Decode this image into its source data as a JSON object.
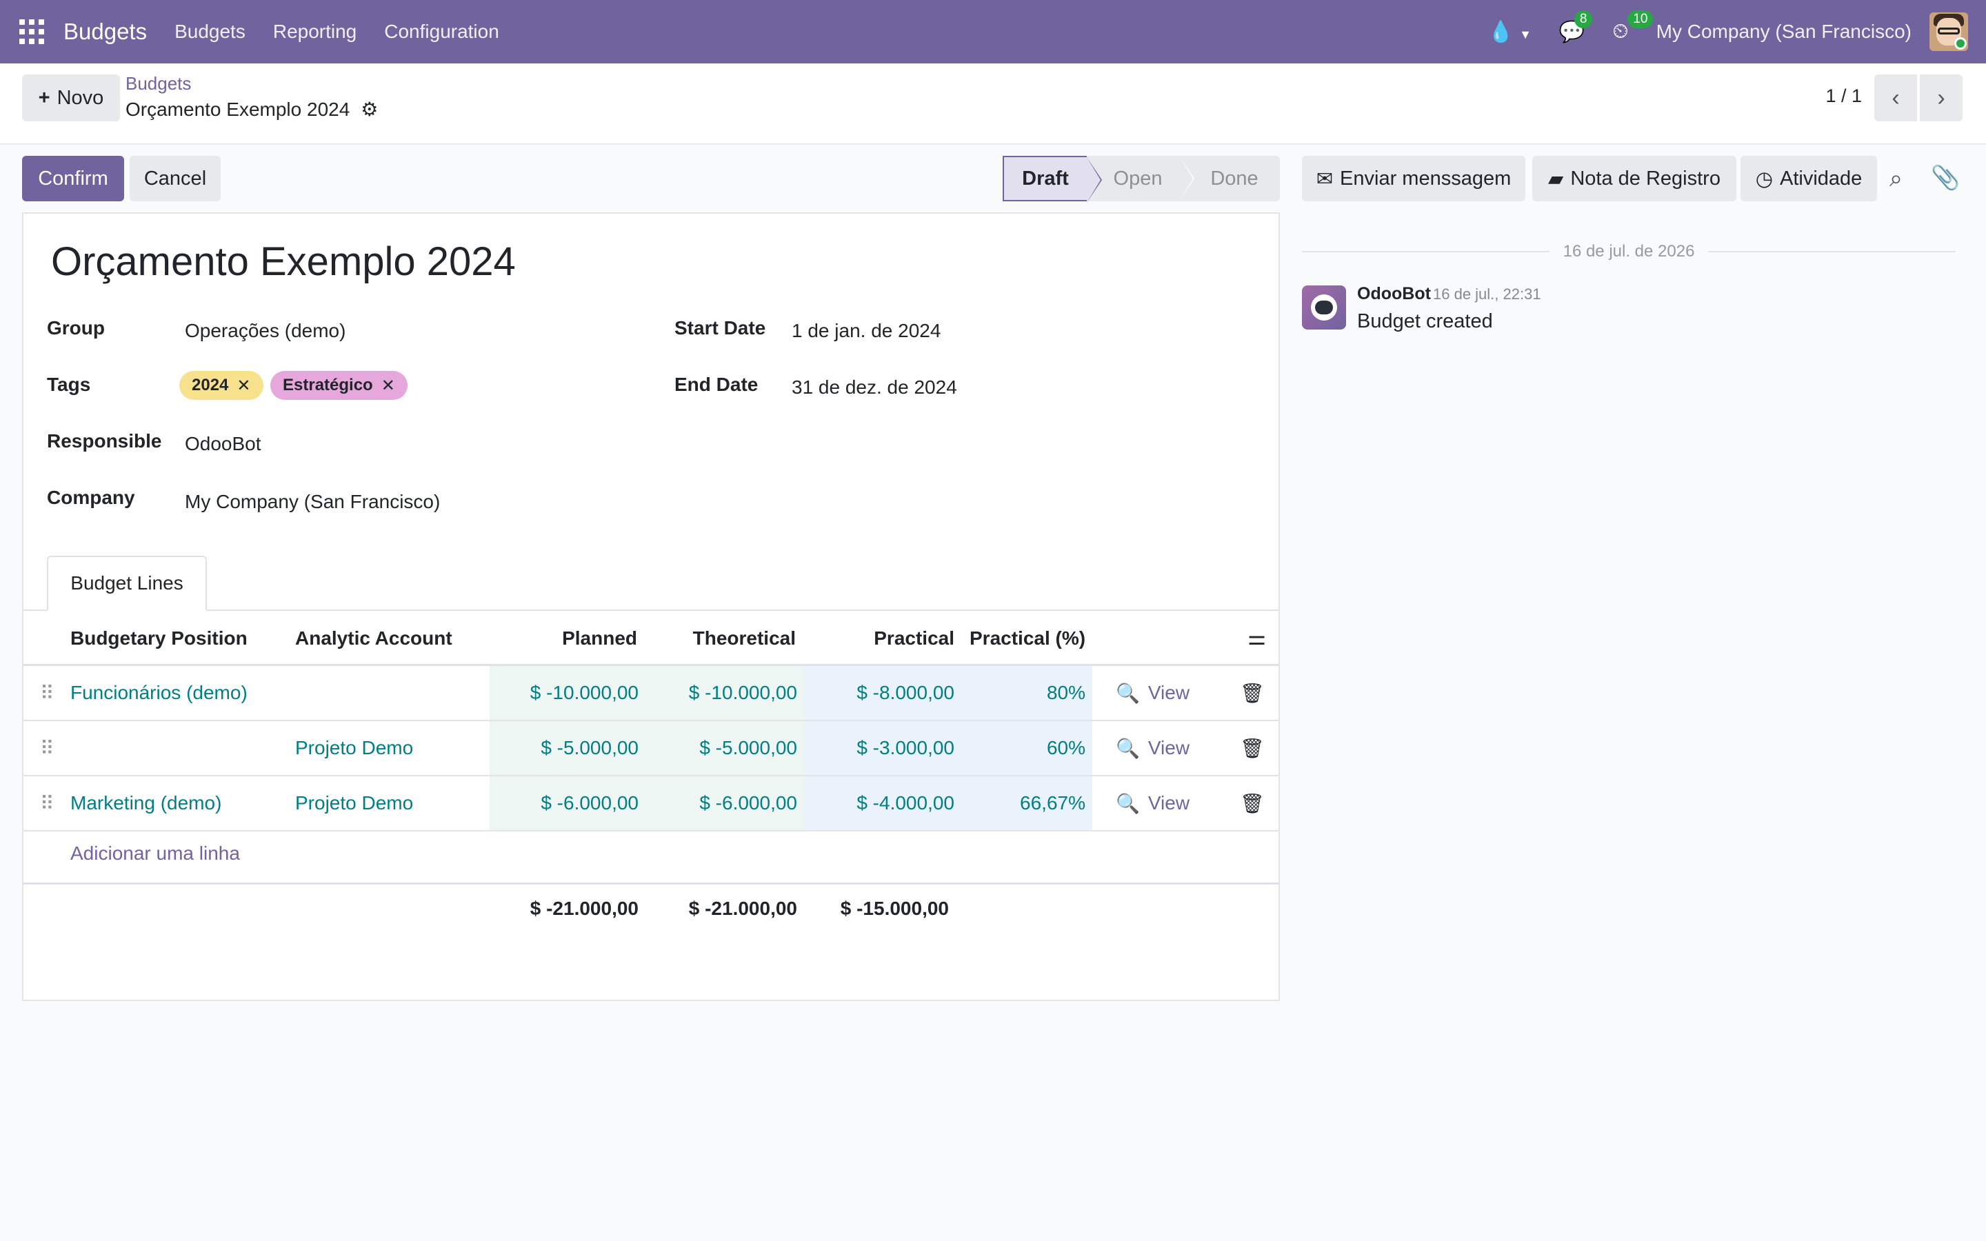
{
  "navbar": {
    "app_name": "Budgets",
    "menu": [
      "Budgets",
      "Reporting",
      "Configuration"
    ],
    "messages_count": "8",
    "activities_count": "10",
    "company": "My Company (San Francisco)"
  },
  "control": {
    "new_label": "Novo",
    "breadcrumb_parent": "Budgets",
    "breadcrumb_current": "Orçamento Exemplo 2024",
    "pager": "1 / 1"
  },
  "actions": {
    "confirm": "Confirm",
    "cancel": "Cancel"
  },
  "status": {
    "stages": [
      "Draft",
      "Open",
      "Done"
    ],
    "current": "Draft"
  },
  "chatter_buttons": {
    "send_message": "Enviar menssagem",
    "log_note": "Nota de Registro",
    "activity": "Atividade"
  },
  "form": {
    "title": "Orçamento Exemplo 2024",
    "labels": {
      "group": "Group",
      "tags": "Tags",
      "responsible": "Responsible",
      "company": "Company",
      "start_date": "Start Date",
      "end_date": "End Date"
    },
    "values": {
      "group": "Operações (demo)",
      "tags": [
        "2024",
        "Estratégico"
      ],
      "responsible": "OdooBot",
      "company": "My Company (San Francisco)",
      "start_date": "1 de jan. de 2024",
      "end_date": "31 de dez. de 2024"
    },
    "tab": "Budget Lines"
  },
  "table": {
    "headers": [
      "Budgetary Position",
      "Analytic Account",
      "Planned",
      "Theoretical",
      "Practical",
      "Practical (%)"
    ],
    "rows": [
      {
        "position": "Funcionários (demo)",
        "account": "",
        "planned": "$ -10.000,00",
        "theoretical": "$ -10.000,00",
        "practical": "$ -8.000,00",
        "percent": "80%",
        "view": "View"
      },
      {
        "position": "",
        "account": "Projeto Demo",
        "planned": "$ -5.000,00",
        "theoretical": "$ -5.000,00",
        "practical": "$ -3.000,00",
        "percent": "60%",
        "view": "View"
      },
      {
        "position": "Marketing (demo)",
        "account": "Projeto Demo",
        "planned": "$ -6.000,00",
        "theoretical": "$ -6.000,00",
        "practical": "$ -4.000,00",
        "percent": "66,67%",
        "view": "View"
      }
    ],
    "add_line": "Adicionar uma linha",
    "totals": {
      "planned": "$ -21.000,00",
      "theoretical": "$ -21.000,00",
      "practical": "$ -15.000,00"
    }
  },
  "chatter": {
    "date": "16 de jul. de 2026",
    "author": "OdooBot",
    "time": "16 de jul., 22:31",
    "body": "Budget created"
  },
  "colors": {
    "brand": "#71639e",
    "link": "#017e84",
    "badge": "#28a745"
  }
}
